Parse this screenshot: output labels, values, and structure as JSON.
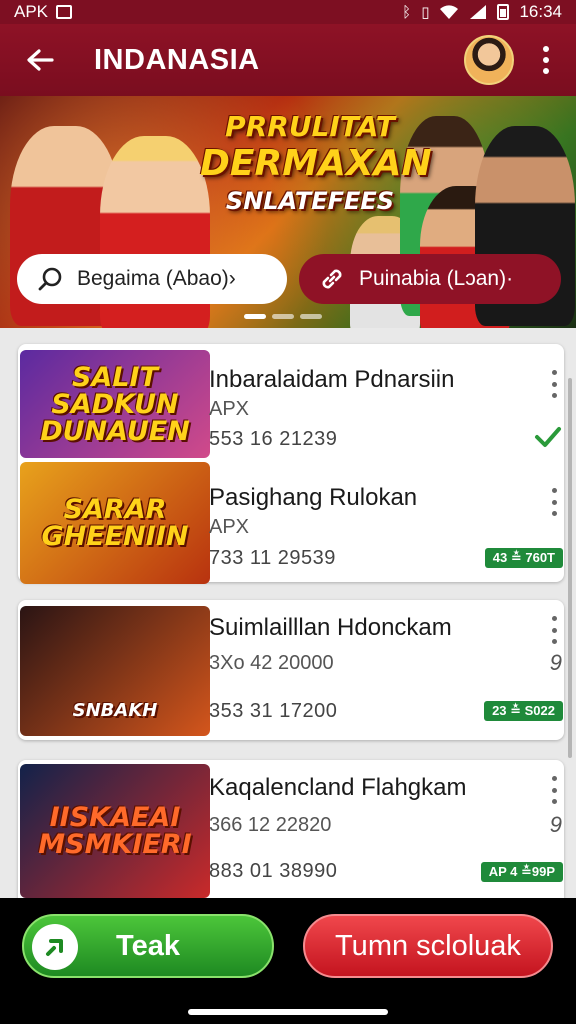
{
  "status_bar": {
    "left_text": "APK",
    "time": "16:34"
  },
  "app_bar": {
    "title": "INDANASIA"
  },
  "banner": {
    "line1": "PRRULITAT",
    "line2": "DERMAXAN",
    "line3": "SNLATEFEES",
    "search_pill": "Begaima (Abao)›",
    "link_pill": "Puinabia (Lɔan)·",
    "carousel_count": 3,
    "carousel_active": 0
  },
  "list": {
    "items": [
      {
        "thumb_text": "SALIT SADKUN DUNAUEN",
        "thumb_colors": [
          "#5b2aa0",
          "#d14a8a"
        ],
        "title": "Inbaralaidam Pdnarsiin",
        "subtitle": "APX",
        "number": "553 16 21239",
        "status": "check"
      },
      {
        "thumb_text": "SARAR GHEENIIN",
        "thumb_colors": [
          "#e8a21c",
          "#b8320f"
        ],
        "title": "Pasighang Rulokan",
        "subtitle": "APX",
        "number": "733 11 29539",
        "badge": "43 ≛ 760T"
      },
      {
        "thumb_text": "SNBAKH",
        "thumb_colors": [
          "#2a1414",
          "#d4561c"
        ],
        "title": "Suimlailllan Hdonckam",
        "subtitle": "3Xo 42 20000",
        "side_number": "9",
        "number": "353 31 17200",
        "badge": "23 ≛ S022"
      },
      {
        "thumb_text": "IISKAEAI MSMKIERI",
        "thumb_colors": [
          "#12224a",
          "#c92a2a"
        ],
        "title": "Kaqalencland Flahgkam",
        "subtitle": "366 12 22820",
        "side_number": "9",
        "number": "883 01 38990",
        "badge": "AP 4 ≛99P"
      }
    ]
  },
  "bottom": {
    "primary_label": "Teak",
    "secondary_label": "Tumn scloluak"
  },
  "colors": {
    "brand": "#8e1226",
    "green": "#1f8a3a",
    "red": "#d6222b"
  }
}
